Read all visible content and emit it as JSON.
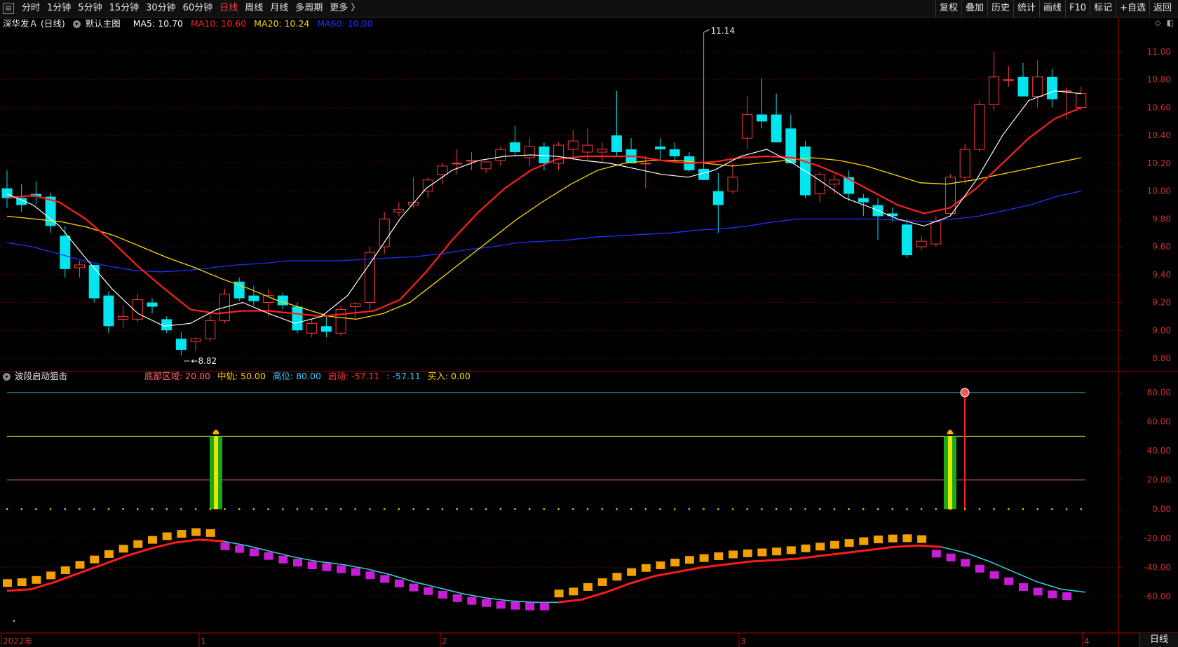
{
  "toolbar": {
    "left_items": [
      "分时",
      "1分钟",
      "5分钟",
      "15分钟",
      "30分钟",
      "60分钟",
      "日线",
      "周线",
      "月线",
      "多周期",
      "更多 〉"
    ],
    "active_item": "日线",
    "right_items": [
      "复权",
      "叠加",
      "历史",
      "统计",
      "画线",
      "F10",
      "标记",
      "+自选",
      "返回"
    ]
  },
  "main_chart": {
    "stock_name": "深华发Ａ (日线)",
    "template": "默认主图",
    "ma_labels": [
      {
        "text": "MA5: 10.70",
        "color": "#ffffff"
      },
      {
        "text": "MA10: 10.60",
        "color": "#ff2020"
      },
      {
        "text": "MA20: 10.24",
        "color": "#ffd700"
      },
      {
        "text": "MA60: 10.00",
        "color": "#2030ff"
      }
    ],
    "y_ticks": [
      "11.00",
      "10.80",
      "10.60",
      "10.40",
      "10.20",
      "10.00",
      "9.80",
      "9.60",
      "9.40",
      "9.20",
      "9.00",
      "8.80"
    ],
    "high_marker": "11.14",
    "low_marker": "8.82"
  },
  "indicator": {
    "name": "波段启动狙击",
    "params": [
      {
        "text": "底部区域: 20.00",
        "color": "#ff6a6a"
      },
      {
        "text": "中轨: 50.00",
        "color": "#ffd700"
      },
      {
        "text": "高位: 80.00",
        "color": "#33ccff"
      },
      {
        "text": "启动: -57.11",
        "color": "#ff3333"
      },
      {
        "text": ": -57.11",
        "color": "#33ccff"
      },
      {
        "text": "买入: 0.00",
        "color": "#ffd700"
      }
    ],
    "y_ticks": [
      "80.00",
      "60.00",
      "40.00",
      "20.00",
      "0.00",
      "-20.00",
      "-40.00",
      "-60.00"
    ]
  },
  "x_axis": {
    "labels": [
      "2022年",
      "1",
      "2",
      "3",
      "4"
    ]
  },
  "bottom_tab": "日线",
  "colors": {
    "up": "#ff3b3b",
    "down": "#00e5ee",
    "ma5": "#ffffff",
    "ma10": "#ff2020",
    "ma20": "#ffd700",
    "ma60": "#2030ff"
  }
}
